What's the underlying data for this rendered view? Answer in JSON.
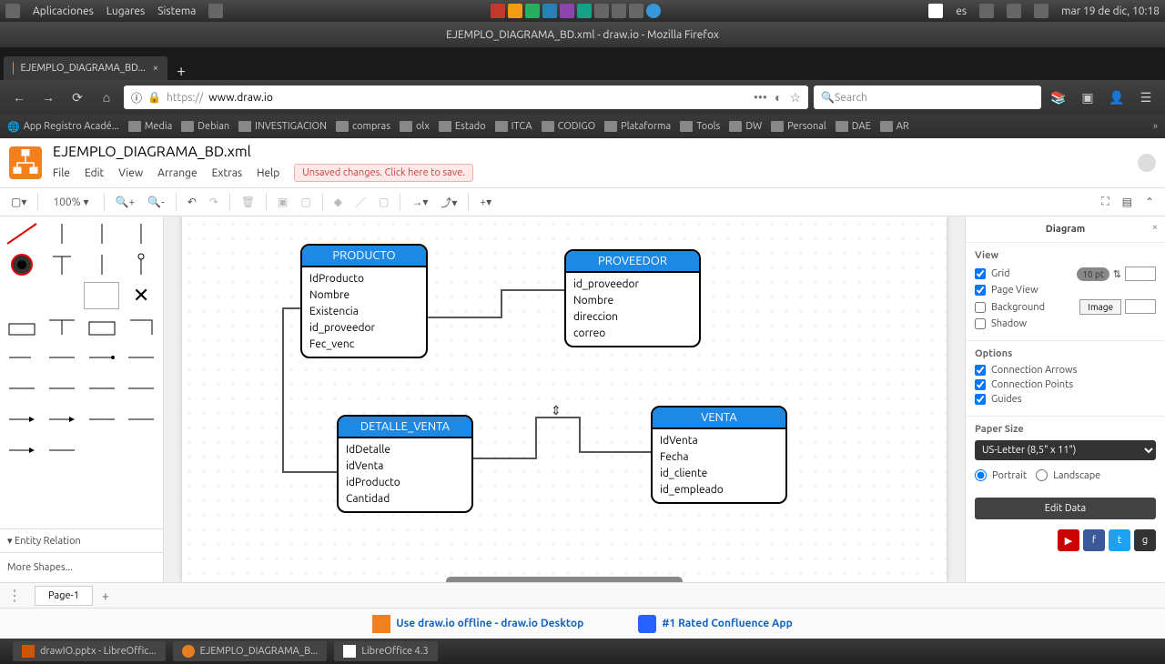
{
  "os_taskbar": {
    "apps": "Aplicaciones",
    "places": "Lugares",
    "system": "Sistema",
    "lang": "es",
    "date": "mar 19 de dic, 10:18"
  },
  "window_title": "EJEMPLO_DIAGRAMA_BD.xml - draw.io - Mozilla Firefox",
  "browser": {
    "tab": "EJEMPLO_DIAGRAMA_BD...",
    "url_prefix": "https://",
    "url": "www.draw.io",
    "search_ph": "Search",
    "bookmarks": [
      "App Registro Acadé...",
      "Media",
      "Debian",
      "INVESTIGACION",
      "compras",
      "olx",
      "Estado",
      "ITCA",
      "CODIGO",
      "Plataforma",
      "Tools",
      "DW",
      "Personal",
      "DAE",
      "AR"
    ]
  },
  "drawio": {
    "doc_title": "EJEMPLO_DIAGRAMA_BD.xml",
    "menu": [
      "File",
      "Edit",
      "View",
      "Arrange",
      "Extras",
      "Help"
    ],
    "unsaved": "Unsaved changes. Click here to save.",
    "zoom": "100%",
    "sidebar_cat": "Entity Relation",
    "more_shapes": "More Shapes...",
    "page": "Page-1",
    "promo1": "Use draw.io offline - draw.io Desktop",
    "promo2": "#1 Rated Confluence App"
  },
  "entities": {
    "producto": {
      "title": "PRODUCTO",
      "fields": [
        "IdProducto",
        "Nombre",
        "Existencia",
        "id_proveedor",
        "Fec_venc"
      ]
    },
    "proveedor": {
      "title": "PROVEEDOR",
      "fields": [
        "id_proveedor",
        "Nombre",
        "direccion",
        "correo"
      ]
    },
    "detalle": {
      "title": "DETALLE_VENTA",
      "fields": [
        "IdDetalle",
        "idVenta",
        "idProducto",
        "Cantidad"
      ]
    },
    "venta": {
      "title": "VENTA",
      "fields": [
        "IdVenta",
        "Fecha",
        "id_cliente",
        "id_empleado"
      ]
    }
  },
  "panel": {
    "title": "Diagram",
    "view": "View",
    "grid": "Grid",
    "grid_val": "10 pt",
    "pageview": "Page View",
    "background": "Background",
    "image": "Image",
    "shadow": "Shadow",
    "options": "Options",
    "conn_arrows": "Connection Arrows",
    "conn_points": "Connection Points",
    "guides": "Guides",
    "paper": "Paper Size",
    "paper_val": "US-Letter (8,5\" x 11\")",
    "portrait": "Portrait",
    "landscape": "Landscape",
    "editdata": "Edit Data"
  },
  "bottom": {
    "t1": "drawIO.pptx - LibreOffic...",
    "t2": "EJEMPLO_DIAGRAMA_B...",
    "t3": "LibreOffice 4.3"
  }
}
